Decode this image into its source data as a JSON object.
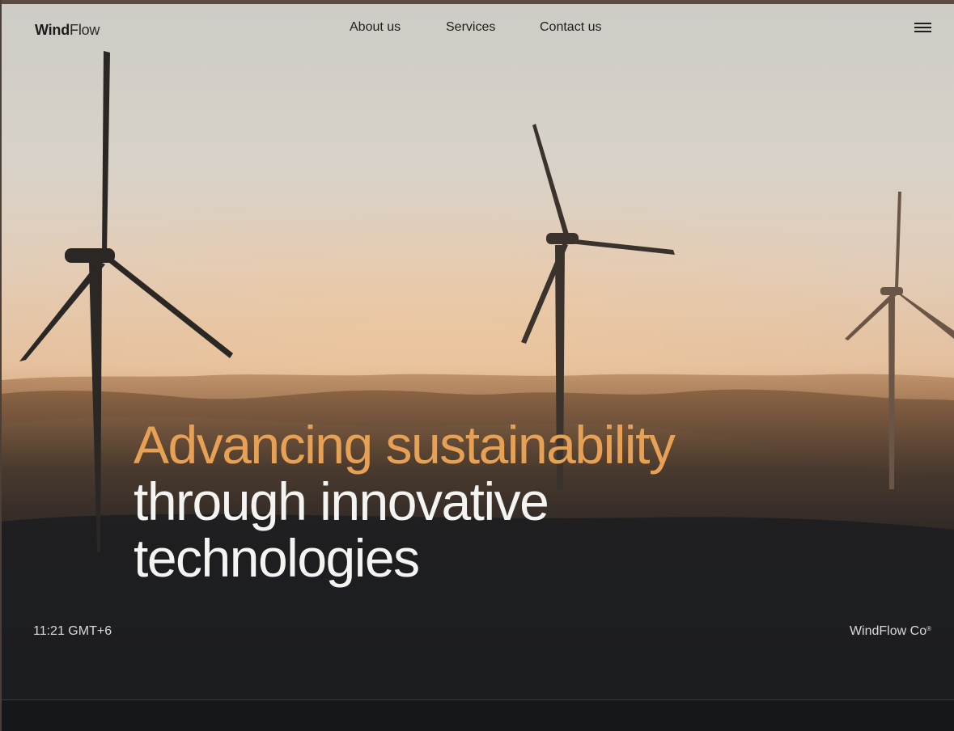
{
  "brand": {
    "name_bold": "Wind",
    "name_light": "Flow"
  },
  "nav": {
    "items": [
      {
        "label": "About us"
      },
      {
        "label": "Services"
      },
      {
        "label": "Contact us"
      }
    ],
    "menu_icon": "hamburger-menu-icon"
  },
  "hero": {
    "headline_line1": "Advancing sustainability",
    "headline_line2": "through innovative",
    "headline_line3": "technologies",
    "accent_color": "#e6a154",
    "image_subject": "wind-turbines-at-sunset"
  },
  "footer_bar": {
    "time": "11:21 GMT+6",
    "company": "WindFlow Co",
    "company_mark": "®"
  }
}
